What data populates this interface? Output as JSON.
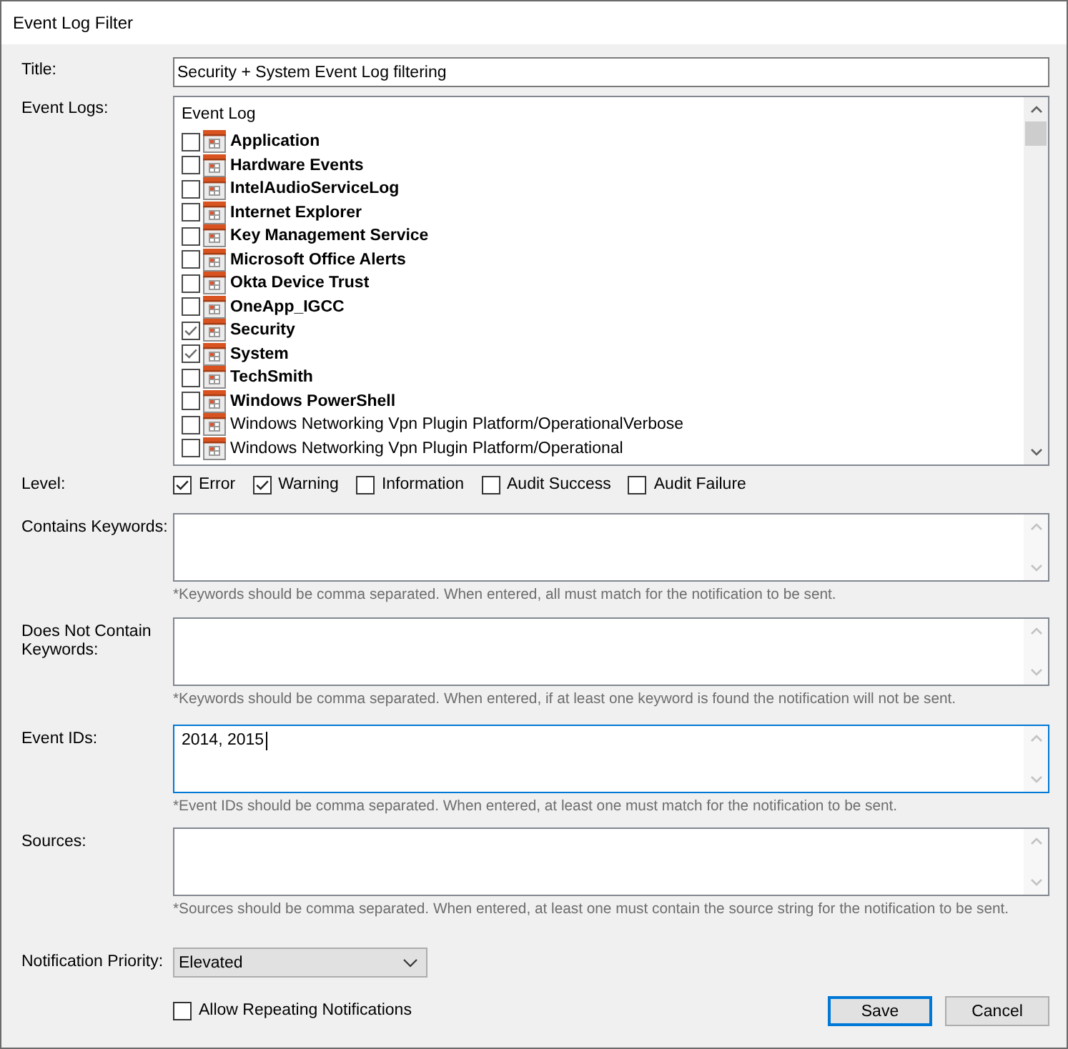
{
  "window": {
    "title": "Event Log Filter"
  },
  "title_field": {
    "label": "Title:",
    "value": "Security + System Event Log filtering"
  },
  "event_logs": {
    "label": "Event Logs:",
    "header": "Event Log",
    "items": [
      {
        "name": "Application",
        "checked": false,
        "emphasized": true
      },
      {
        "name": "Hardware Events",
        "checked": false,
        "emphasized": true
      },
      {
        "name": "IntelAudioServiceLog",
        "checked": false,
        "emphasized": true
      },
      {
        "name": "Internet Explorer",
        "checked": false,
        "emphasized": true
      },
      {
        "name": "Key Management Service",
        "checked": false,
        "emphasized": true
      },
      {
        "name": "Microsoft Office Alerts",
        "checked": false,
        "emphasized": true
      },
      {
        "name": "Okta Device Trust",
        "checked": false,
        "emphasized": true
      },
      {
        "name": "OneApp_IGCC",
        "checked": false,
        "emphasized": true
      },
      {
        "name": "Security",
        "checked": true,
        "emphasized": true
      },
      {
        "name": "System",
        "checked": true,
        "emphasized": true
      },
      {
        "name": "TechSmith",
        "checked": false,
        "emphasized": true
      },
      {
        "name": "Windows PowerShell",
        "checked": false,
        "emphasized": true
      },
      {
        "name": "Windows Networking Vpn Plugin Platform/OperationalVerbose",
        "checked": false,
        "emphasized": false
      },
      {
        "name": "Windows Networking Vpn Plugin Platform/Operational",
        "checked": false,
        "emphasized": false
      }
    ]
  },
  "level": {
    "label": "Level:",
    "options": [
      {
        "label": "Error",
        "checked": true
      },
      {
        "label": "Warning",
        "checked": true
      },
      {
        "label": "Information",
        "checked": false
      },
      {
        "label": "Audit Success",
        "checked": false
      },
      {
        "label": "Audit Failure",
        "checked": false
      }
    ]
  },
  "text_fields": [
    {
      "label": "Contains Keywords:",
      "focused": false,
      "hint": "*Keywords should be comma separated. When entered, all must match for the notification to be sent."
    },
    {
      "label": "Does Not Contain Keywords:",
      "focused": false,
      "hint": "*Keywords should be comma separated. When entered, if at least one keyword is found the notification will not be sent."
    },
    {
      "label": "Event IDs:",
      "value": "2014, 2015",
      "focused": true,
      "hint": "*Event IDs should be comma separated. When entered, at least one must match for the notification to be sent."
    },
    {
      "label": "Sources:",
      "focused": false,
      "hint": "*Sources should be comma separated. When entered, at least one must contain the source string for the notification to be sent."
    }
  ],
  "notification_priority": {
    "label": "Notification Priority:",
    "value": "Elevated"
  },
  "allow_repeating": {
    "label": "Allow Repeating Notifications",
    "checked": false
  },
  "buttons": [
    {
      "label": "Save",
      "default": true
    },
    {
      "label": "Cancel",
      "default": false
    }
  ]
}
